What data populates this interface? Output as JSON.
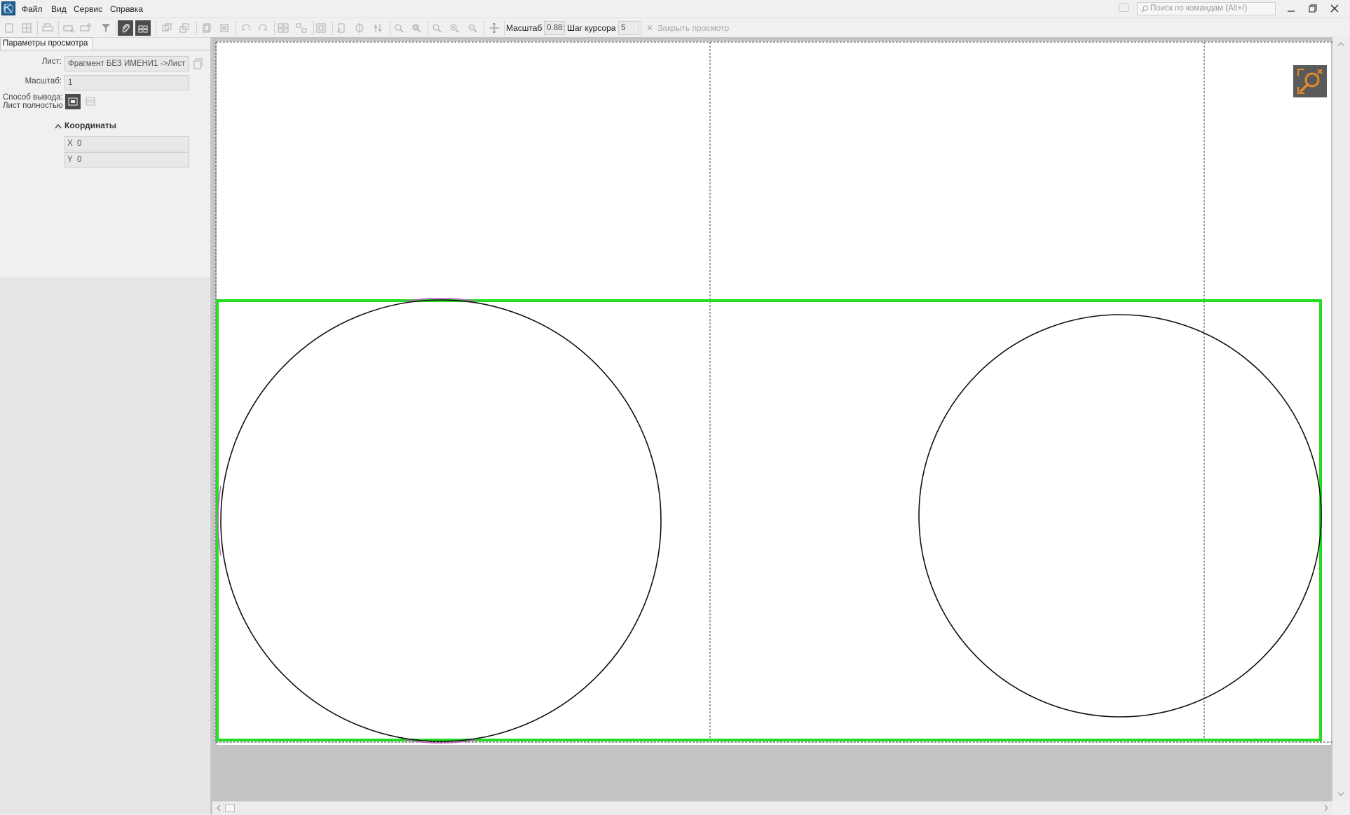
{
  "menu": {
    "items": [
      {
        "label": "Файл",
        "name": "menu-file"
      },
      {
        "label": "Вид",
        "name": "menu-view"
      },
      {
        "label": "Сервис",
        "name": "menu-service"
      },
      {
        "label": "Справка",
        "name": "menu-help"
      }
    ],
    "search_placeholder": "Поиск по командам (Alt+/)"
  },
  "toolbar": {
    "scale_label": "Масштаб",
    "scale_value": "0.88:",
    "cursor_step_label": "Шаг курсора",
    "cursor_step_value": "5",
    "close_preview_label": "Закрыть просмотр"
  },
  "panel": {
    "tab_label": "Параметры просмотра",
    "sheet_label": "Лист:",
    "sheet_value": "Фрагмент БЕЗ ИМЕНИ1 ->Лист",
    "scale_label": "Масштаб:",
    "scale_value": "1",
    "output_label": "Способ вывода:",
    "output_value": "Лист полностью",
    "coords_header": "Координаты",
    "x_key": "X",
    "x_value": "0",
    "y_key": "Y",
    "y_value": "0"
  },
  "colors": {
    "print_area_border": "#22dd22",
    "app_accent": "#1f5f8f",
    "zoom_icon": "#e58a2a"
  }
}
